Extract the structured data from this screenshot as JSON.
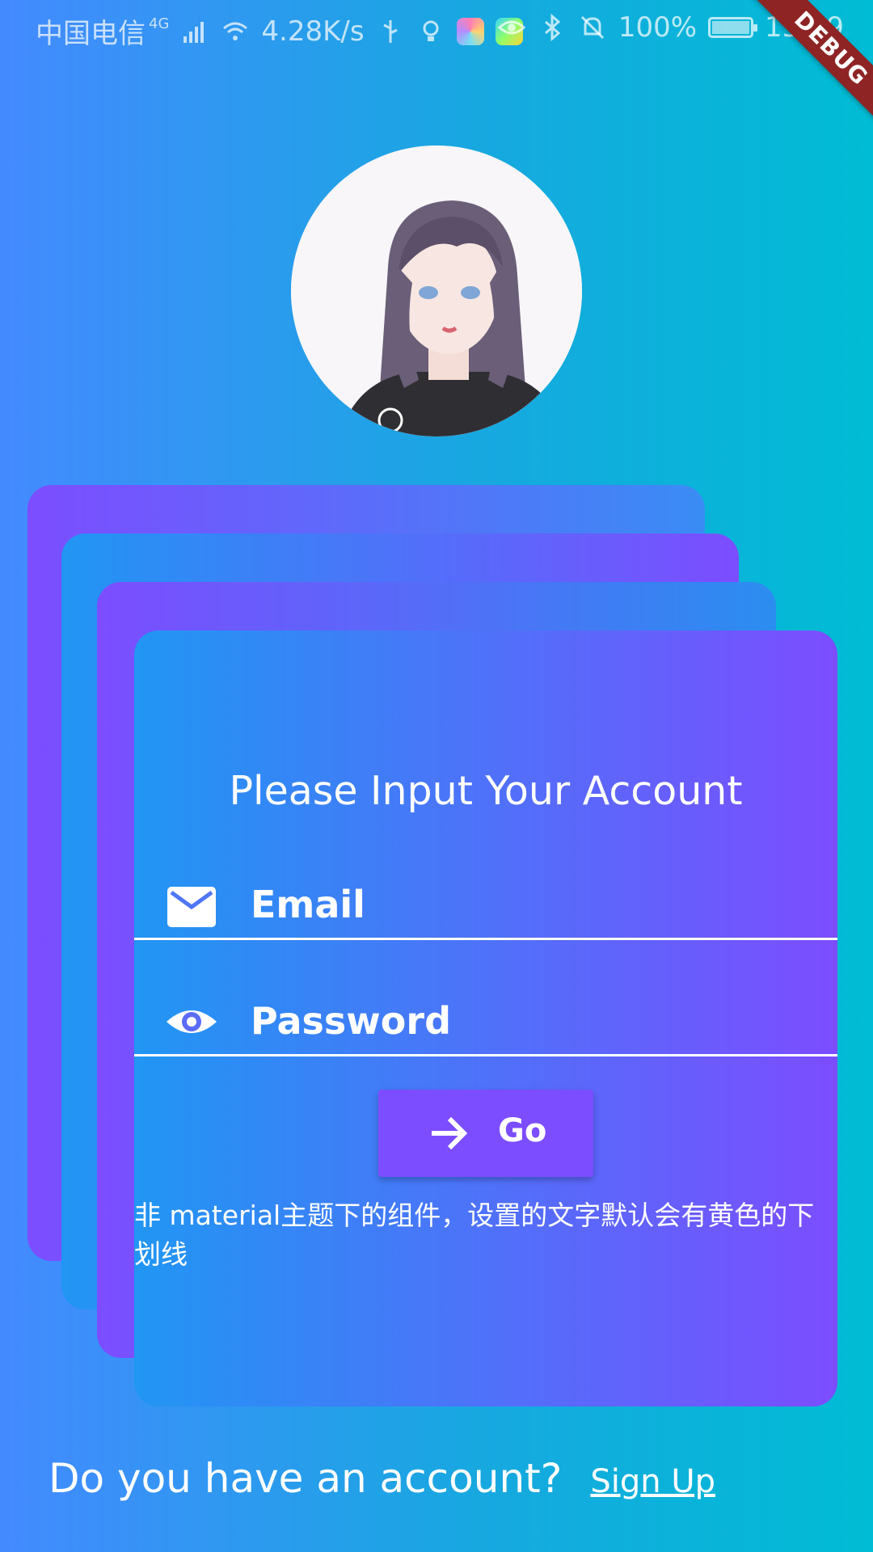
{
  "status_bar": {
    "carrier": "中国电信",
    "network": "4G",
    "speed": "4.28K/s",
    "battery": "100%",
    "time": "15:09",
    "icons": [
      "signal-icon",
      "wifi-icon",
      "usb-icon",
      "bulb-icon",
      "gallery-app-icon",
      "video-app-icon",
      "eye-icon",
      "bluetooth-icon",
      "mute-bell-icon",
      "battery-icon"
    ]
  },
  "debug_banner": "DEBUG",
  "avatar": {
    "icon": "avatar-illustration"
  },
  "form": {
    "title": "Please Input Your Account",
    "email_label": "Email",
    "password_label": "Password",
    "go_label": "Go",
    "note": "非 material主题下的组件，设置的文字默认会有黄色的下划线"
  },
  "footer": {
    "question": "Do you have an account?",
    "signup_label": "Sign Up"
  },
  "colors": {
    "accent": "#7C4DFF",
    "blue": "#2196F3",
    "background_start": "#448AFF",
    "background_end": "#00BCD4",
    "debug_banner": "#8E2424"
  }
}
